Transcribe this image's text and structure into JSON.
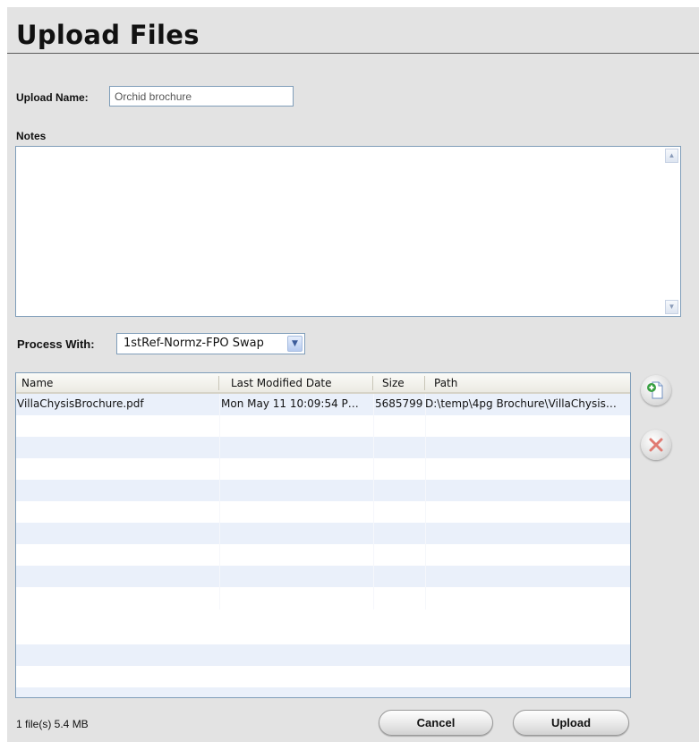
{
  "header": {
    "title": "Upload Files"
  },
  "form": {
    "upload_name_label": "Upload Name:",
    "upload_name_value": "Orchid brochure",
    "notes_label": "Notes",
    "notes_value": "",
    "process_label": "Process With:",
    "process_value": "1stRef-Normz-FPO Swap"
  },
  "files_table": {
    "columns": [
      "Name",
      "Last Modified Date",
      "Size",
      "Path"
    ],
    "rows": [
      {
        "name": "VillaChysisBrochure.pdf",
        "modified": "Mon May 11 10:09:54 P…",
        "size": "5685799",
        "path": "D:\\temp\\4pg Brochure\\VillaChysis…"
      }
    ]
  },
  "side_actions": {
    "add_icon": "add-file-icon",
    "remove_icon": "remove-x-icon"
  },
  "footer": {
    "status": "1 file(s) 5.4 MB",
    "cancel_label": "Cancel",
    "upload_label": "Upload"
  },
  "colors": {
    "panel_bg": "#e3e3e3",
    "row_stripe": "#eaf0fa",
    "remove_red": "#e07a72",
    "add_green": "#3aa043"
  }
}
